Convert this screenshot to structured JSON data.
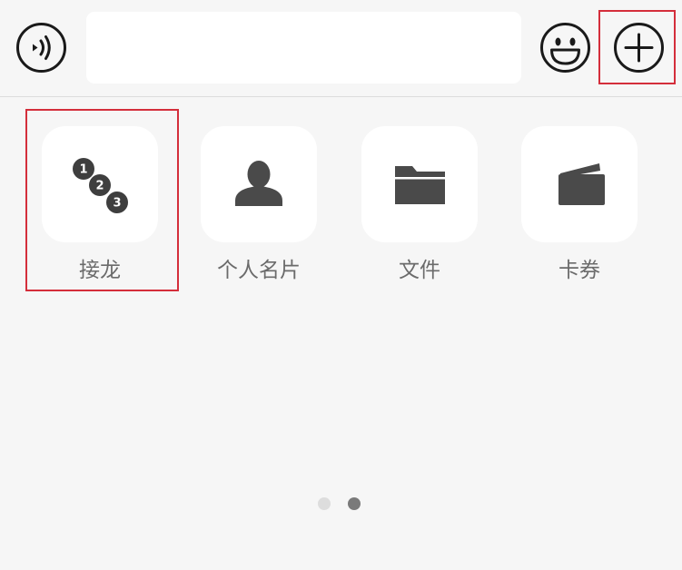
{
  "toolbar": {
    "input_value": "",
    "voice_icon": "voice-wave-icon",
    "emoji_icon": "smiley-icon",
    "more_icon": "plus-circle-icon"
  },
  "panel": {
    "items": [
      {
        "label": "接龙",
        "icon": "numbered-chain-icon",
        "badge_numbers": [
          "1",
          "2",
          "3"
        ]
      },
      {
        "label": "个人名片",
        "icon": "person-card-icon"
      },
      {
        "label": "文件",
        "icon": "folder-icon"
      },
      {
        "label": "卡券",
        "icon": "wallet-card-icon"
      }
    ]
  },
  "pager": {
    "page_count": 2,
    "current_page": 2
  },
  "colors": {
    "background": "#f6f6f6",
    "tile": "#ffffff",
    "icon": "#4a4a4a",
    "label": "#6b6b6b",
    "highlight": "#d42e3b",
    "dot_active": "#7a7a7a",
    "dot_inactive": "#dddddd"
  }
}
